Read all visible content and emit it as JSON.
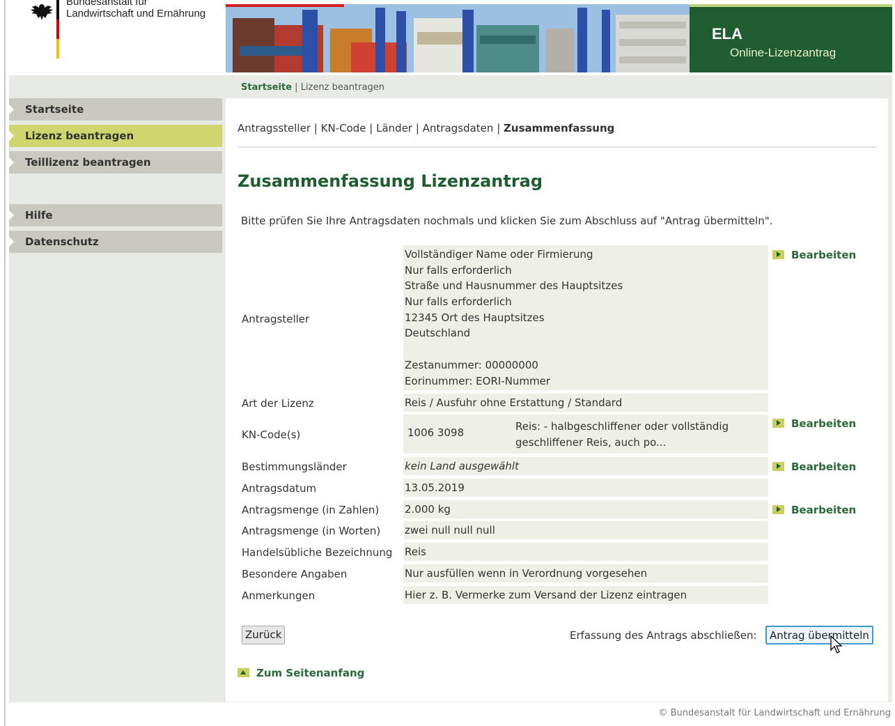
{
  "header": {
    "agency_name": "Bundesanstalt für\nLandwirtschaft und Ernährung",
    "app_title": "ELA",
    "app_subtitle": "Online-Lizenzantrag"
  },
  "breadcrumb": {
    "home": "Startseite",
    "separator": "|",
    "current": "Lizenz beantragen"
  },
  "sidebar": {
    "items": [
      {
        "label": "Startseite"
      },
      {
        "label": "Lizenz beantragen",
        "active": true
      },
      {
        "label": "Teillizenz beantragen"
      },
      {
        "label": "Hilfe"
      },
      {
        "label": "Datenschutz"
      }
    ]
  },
  "steps": {
    "items": [
      "Antragssteller",
      "KN-Code",
      "Länder",
      "Antragsdaten"
    ],
    "current": "Zusammenfassung",
    "separator": "|"
  },
  "page_title": "Zusammenfassung Lizenzantrag",
  "intro": "Bitte prüfen Sie Ihre Antragsdaten nochmals und klicken Sie zum Abschluss auf \"Antrag übermitteln\".",
  "summary": {
    "applicant": {
      "label": "Antragsteller",
      "lines": [
        "Vollständiger Name oder Firmierung",
        "Nur falls erforderlich",
        "Straße und Hausnummer des Hauptsitzes",
        "Nur falls erforderlich",
        "12345 Ort des Hauptsitzes",
        "Deutschland",
        "",
        "Zestanummer: 00000000",
        "Eorinummer: EORI-Nummer"
      ]
    },
    "license_type": {
      "label": "Art der Lizenz",
      "value": "Reis / Ausfuhr ohne Erstattung / Standard"
    },
    "kn_code": {
      "label": "KN-Code(s)",
      "code": "1006 3098",
      "description_line1": "Reis: - halbgeschliffener oder vollständig",
      "description_line2": "geschliffener Reis, auch po..."
    },
    "countries": {
      "label": "Bestimmungsländer",
      "value": "kein Land ausgewählt"
    },
    "date": {
      "label": "Antragsdatum",
      "value": "13.05.2019"
    },
    "qty_num": {
      "label": "Antragsmenge (in Zahlen)",
      "value": "2.000 kg"
    },
    "qty_words": {
      "label": "Antragsmenge (in Worten)",
      "value": "zwei null null null"
    },
    "trade_name": {
      "label": "Handelsübliche Bezeichnung",
      "value": "Reis"
    },
    "special": {
      "label": "Besondere Angaben",
      "value": "Nur ausfüllen wenn in Verordnung vorgesehen"
    },
    "remarks": {
      "label": "Anmerkungen",
      "value": "Hier z. B. Vermerke zum Versand der Lizenz eintragen"
    }
  },
  "edit_label": "Bearbeiten",
  "actions": {
    "back": "Zurück",
    "finish_label": "Erfassung des Antrags abschließen:",
    "submit": "Antrag übermitteln"
  },
  "to_top": "Zum Seitenanfang",
  "footer": "© Bundesanstalt für Landwirtschaft und Ernährung",
  "colors": {
    "brand_green": "#1f5d30",
    "link_green": "#2a6a3a",
    "active_nav": "#cfd66e",
    "nav_grey": "#c9c9c0",
    "value_bg": "#eef0e8"
  }
}
